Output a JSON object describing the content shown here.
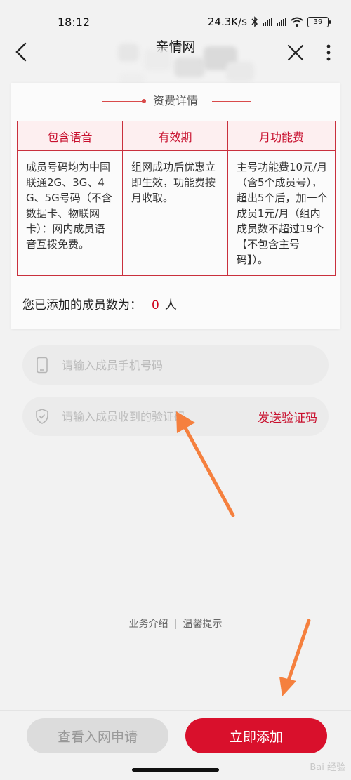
{
  "status_bar": {
    "time": "18:12",
    "network_speed": "24.3K/s",
    "battery": "39"
  },
  "nav": {
    "title": "亲情网"
  },
  "card": {
    "heading": "资费详情",
    "table": {
      "headers": [
        "包含语音",
        "有效期",
        "月功能费"
      ],
      "cells": [
        "成员号码均为中国联通2G、3G、4G、5G号码（不含数据卡、物联网卡）：网内成员语音互拨免费。",
        "组网成功后优惠立即生效，功能费按月收取。",
        "主号功能费10元/月（含5个成员号），超出5个后，加一个成员1元/月（组内成员数不超过19个【不包含主号码】）。"
      ]
    },
    "member_count_label": "您已添加的成员数为：",
    "member_count_value": "0",
    "member_count_unit": "人"
  },
  "form": {
    "phone_placeholder": "请输入成员手机号码",
    "code_placeholder": "请输入成员收到的验证码",
    "send_code_label": "发送验证码"
  },
  "links": {
    "intro": "业务介绍",
    "tips": "温馨提示"
  },
  "bottom": {
    "view_label": "查看入网申请",
    "add_label": "立即添加"
  },
  "watermark": "Bai 经验",
  "colors": {
    "accent": "#d9102c",
    "annotation_arrow": "#f5803e"
  }
}
